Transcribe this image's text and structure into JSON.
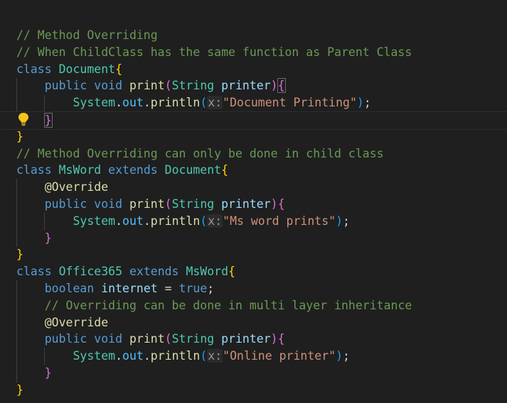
{
  "editor": {
    "lines": [
      {
        "tokens": [
          {
            "t": "// Method Overriding",
            "c": "comment"
          }
        ]
      },
      {
        "tokens": [
          {
            "t": "// When ChildClass has the same function as Parent Class",
            "c": "comment"
          }
        ]
      },
      {
        "tokens": [
          {
            "t": "class ",
            "c": "keyword"
          },
          {
            "t": "Document",
            "c": "type"
          },
          {
            "t": "{",
            "c": "brace1"
          }
        ]
      },
      {
        "tokens": [
          {
            "t": "    ",
            "c": "plain"
          },
          {
            "t": "public ",
            "c": "keyword"
          },
          {
            "t": "void ",
            "c": "keyword"
          },
          {
            "t": "print",
            "c": "method"
          },
          {
            "t": "(",
            "c": "brace2"
          },
          {
            "t": "String ",
            "c": "type"
          },
          {
            "t": "printer",
            "c": "param"
          },
          {
            "t": ")",
            "c": "brace2"
          },
          {
            "t": "{",
            "c": "brace2 match"
          }
        ]
      },
      {
        "tokens": [
          {
            "t": "        ",
            "c": "plain"
          },
          {
            "t": "System",
            "c": "type"
          },
          {
            "t": ".",
            "c": "plain"
          },
          {
            "t": "out",
            "c": "field"
          },
          {
            "t": ".",
            "c": "plain"
          },
          {
            "t": "println",
            "c": "method"
          },
          {
            "t": "(",
            "c": "brace3"
          },
          {
            "t": "x:",
            "c": "hint"
          },
          {
            "t": "\"Document Printing\"",
            "c": "string"
          },
          {
            "t": ")",
            "c": "brace3"
          },
          {
            "t": ";",
            "c": "plain"
          }
        ]
      },
      {
        "tokens": [
          {
            "t": "    ",
            "c": "plain"
          },
          {
            "t": "}",
            "c": "brace2 match"
          }
        ]
      },
      {
        "tokens": [
          {
            "t": "}",
            "c": "brace1"
          }
        ]
      },
      {
        "tokens": [
          {
            "t": "// Method Overriding can only be done in child class",
            "c": "comment"
          }
        ]
      },
      {
        "tokens": [
          {
            "t": "class ",
            "c": "keyword"
          },
          {
            "t": "MsWord ",
            "c": "type"
          },
          {
            "t": "extends ",
            "c": "keyword"
          },
          {
            "t": "Document",
            "c": "type"
          },
          {
            "t": "{",
            "c": "brace1"
          }
        ]
      },
      {
        "tokens": [
          {
            "t": "    ",
            "c": "plain"
          },
          {
            "t": "@Override",
            "c": "annotation"
          }
        ]
      },
      {
        "tokens": [
          {
            "t": "    ",
            "c": "plain"
          },
          {
            "t": "public ",
            "c": "keyword"
          },
          {
            "t": "void ",
            "c": "keyword"
          },
          {
            "t": "print",
            "c": "method"
          },
          {
            "t": "(",
            "c": "brace2"
          },
          {
            "t": "String ",
            "c": "type"
          },
          {
            "t": "printer",
            "c": "param"
          },
          {
            "t": ")",
            "c": "brace2"
          },
          {
            "t": "{",
            "c": "brace2"
          }
        ]
      },
      {
        "tokens": [
          {
            "t": "        ",
            "c": "plain"
          },
          {
            "t": "System",
            "c": "type"
          },
          {
            "t": ".",
            "c": "plain"
          },
          {
            "t": "out",
            "c": "field"
          },
          {
            "t": ".",
            "c": "plain"
          },
          {
            "t": "println",
            "c": "method"
          },
          {
            "t": "(",
            "c": "brace3"
          },
          {
            "t": "x:",
            "c": "hint"
          },
          {
            "t": "\"Ms word prints\"",
            "c": "string"
          },
          {
            "t": ")",
            "c": "brace3"
          },
          {
            "t": ";",
            "c": "plain"
          }
        ]
      },
      {
        "tokens": [
          {
            "t": "    ",
            "c": "plain"
          },
          {
            "t": "}",
            "c": "brace2"
          }
        ]
      },
      {
        "tokens": [
          {
            "t": "}",
            "c": "brace1"
          }
        ]
      },
      {
        "tokens": [
          {
            "t": "class ",
            "c": "keyword"
          },
          {
            "t": "Office365 ",
            "c": "type"
          },
          {
            "t": "extends ",
            "c": "keyword"
          },
          {
            "t": "MsWord",
            "c": "type"
          },
          {
            "t": "{",
            "c": "brace1"
          }
        ]
      },
      {
        "tokens": [
          {
            "t": "    ",
            "c": "plain"
          },
          {
            "t": "boolean ",
            "c": "keyword"
          },
          {
            "t": "internet",
            "c": "param"
          },
          {
            "t": " = ",
            "c": "plain"
          },
          {
            "t": "true",
            "c": "keyword"
          },
          {
            "t": ";",
            "c": "plain"
          }
        ]
      },
      {
        "tokens": [
          {
            "t": "    ",
            "c": "plain"
          },
          {
            "t": "// Overriding can be done in multi layer inheritance",
            "c": "comment"
          }
        ]
      },
      {
        "tokens": [
          {
            "t": "    ",
            "c": "plain"
          },
          {
            "t": "@Override",
            "c": "annotation"
          }
        ]
      },
      {
        "tokens": [
          {
            "t": "    ",
            "c": "plain"
          },
          {
            "t": "public ",
            "c": "keyword"
          },
          {
            "t": "void ",
            "c": "keyword"
          },
          {
            "t": "print",
            "c": "method"
          },
          {
            "t": "(",
            "c": "brace2"
          },
          {
            "t": "String ",
            "c": "type"
          },
          {
            "t": "printer",
            "c": "param"
          },
          {
            "t": ")",
            "c": "brace2"
          },
          {
            "t": "{",
            "c": "brace2"
          }
        ]
      },
      {
        "tokens": [
          {
            "t": "        ",
            "c": "plain"
          },
          {
            "t": "System",
            "c": "type"
          },
          {
            "t": ".",
            "c": "plain"
          },
          {
            "t": "out",
            "c": "field"
          },
          {
            "t": ".",
            "c": "plain"
          },
          {
            "t": "println",
            "c": "method"
          },
          {
            "t": "(",
            "c": "brace3"
          },
          {
            "t": "x:",
            "c": "hint"
          },
          {
            "t": "\"Online printer\"",
            "c": "string"
          },
          {
            "t": ")",
            "c": "brace3"
          },
          {
            "t": ";",
            "c": "plain"
          }
        ]
      },
      {
        "tokens": [
          {
            "t": "    ",
            "c": "plain"
          },
          {
            "t": "}",
            "c": "brace2"
          }
        ]
      },
      {
        "tokens": [
          {
            "t": "}",
            "c": "brace1"
          }
        ]
      }
    ],
    "current_line": 6,
    "lightbulb_icon": "lightbulb-icon",
    "colors": {
      "background": "#1f1f1f",
      "comment": "#6a9955",
      "keyword": "#569cd6",
      "type": "#4ec9b0",
      "method": "#dcdcaa",
      "string": "#ce9178"
    }
  }
}
